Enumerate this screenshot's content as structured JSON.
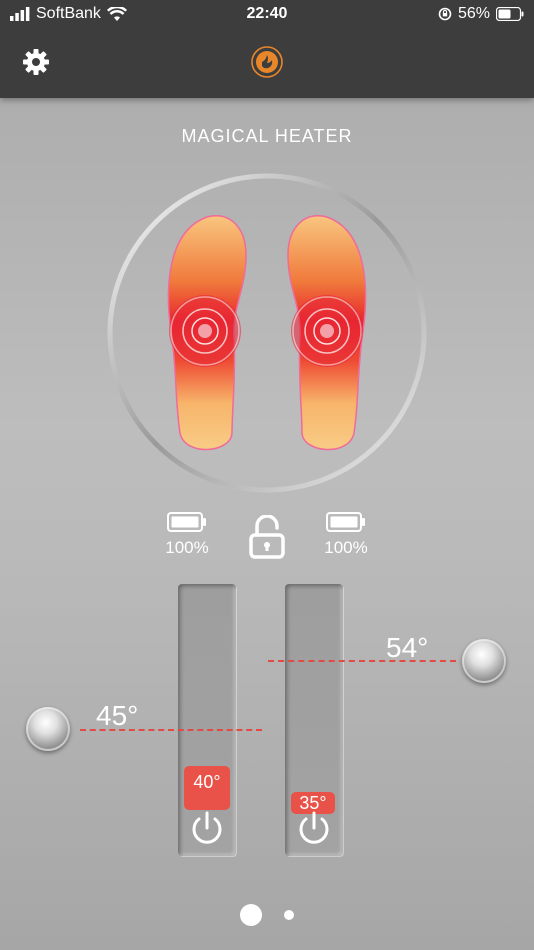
{
  "status_bar": {
    "carrier": "SoftBank",
    "time": "22:40",
    "battery": "56%"
  },
  "app": {
    "title": "MAGICAL HEATER"
  },
  "batteries": {
    "left": "100%",
    "right": "100%"
  },
  "sliders": {
    "left": {
      "value": 40,
      "label": "40°"
    },
    "right": {
      "value": 35,
      "label": "35°"
    }
  },
  "thresholds": {
    "left": {
      "value": 45,
      "label": "45°"
    },
    "right": {
      "value": 54,
      "label": "54°"
    }
  },
  "pager": {
    "count": 2,
    "active": 0
  },
  "colors": {
    "accent": "#e85249",
    "header": "#3d3d3d",
    "logo": "#e8862a"
  },
  "icons": [
    "settings-gear-icon",
    "logo-icon",
    "battery-icon",
    "unlock-icon",
    "power-icon"
  ]
}
